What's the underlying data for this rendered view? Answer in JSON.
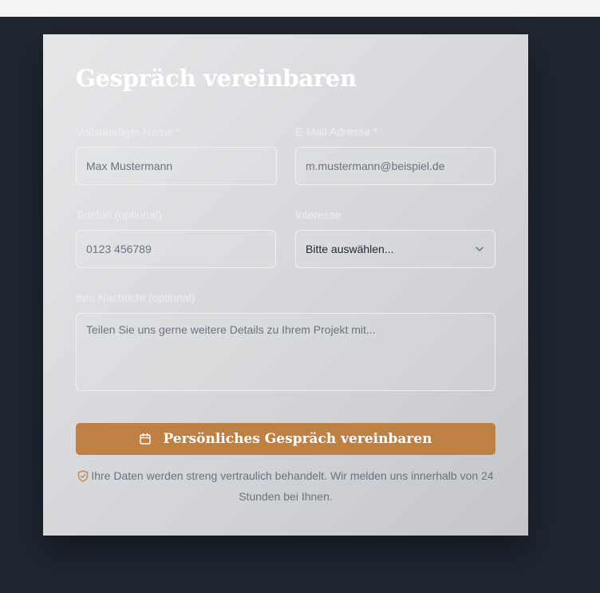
{
  "form": {
    "title": "Gespräch vereinbaren",
    "name": {
      "label": "Vollständiger Name *",
      "placeholder": "Max Mustermann"
    },
    "email": {
      "label": "E-Mail Adresse *",
      "placeholder": "m.mustermann@beispiel.de"
    },
    "phone": {
      "label": "Telefon (optional)",
      "placeholder": "0123 456789"
    },
    "interest": {
      "label": "Interesse",
      "selected": "Bitte auswählen..."
    },
    "message": {
      "label": "Ihre Nachricht (optional)",
      "placeholder": "Teilen Sie uns gerne weitere Details zu Ihrem Projekt mit..."
    },
    "submit_label": "Persönliches Gespräch vereinbaren",
    "privacy_note": "Ihre Daten werden streng vertraulich behandelt. Wir melden uns innerhalb von 24 Stunden bei Ihnen."
  },
  "icons": {
    "submit": "calendar-icon",
    "select": "chevron-down-icon",
    "privacy": "shield-check-icon"
  },
  "colors": {
    "accent": "#bf8143",
    "page_background": "#1f2630"
  }
}
